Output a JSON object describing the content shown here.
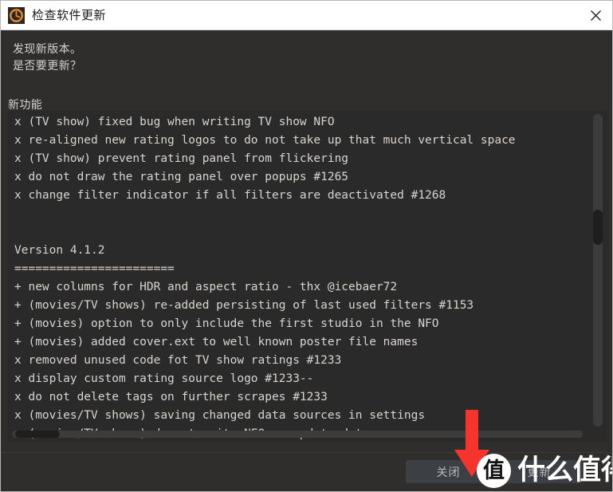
{
  "window": {
    "title": "检查软件更新",
    "icon": "update-clock-icon",
    "close_label": "✕"
  },
  "message": {
    "line1": "发现新版本。",
    "line2": "是否要更新？"
  },
  "section": {
    "label": "新功能"
  },
  "changelog": {
    "text": "x (TV show) fixed bug when writing TV show NFO\nx re-aligned new rating logos to do not take up that much vertical space\nx (TV show) prevent rating panel from flickering\nx do not draw the rating panel over popups #1265\nx change filter indicator if all filters are deactivated #1268\n\n\nVersion 4.1.2\n=======================\n+ new columns for HDR and aspect ratio - thx @icebaer72\n+ (movies/TV shows) re-added persisting of last used filters #1153\n+ (movies) option to only include the first studio in the NFO\n+ (movies) added cover.ext to well known poster file names\nx removed unused code fot TV show ratings #1233\nx display custom rating source logo #1233--\nx do not delete tags on further scrapes #1233\nx (movies/TV shows) saving changed data sources in settings\nx (movies/TV shows) do not write NFO on update data sources"
  },
  "buttons": {
    "close": "关闭",
    "update": "更新"
  },
  "watermark": {
    "badge": "值",
    "text": "什么值得买"
  },
  "annotation": {
    "arrow": "red-down-arrow"
  },
  "colors": {
    "dialog_bg": "#2f2e2d",
    "pane_bg": "#2b2a2a",
    "titlebar_bg": "#ffffff",
    "accent": "#ef8b24",
    "text": "#d8d4cf",
    "button_bg": "#3c3f43",
    "arrow_red": "#f4342d"
  }
}
